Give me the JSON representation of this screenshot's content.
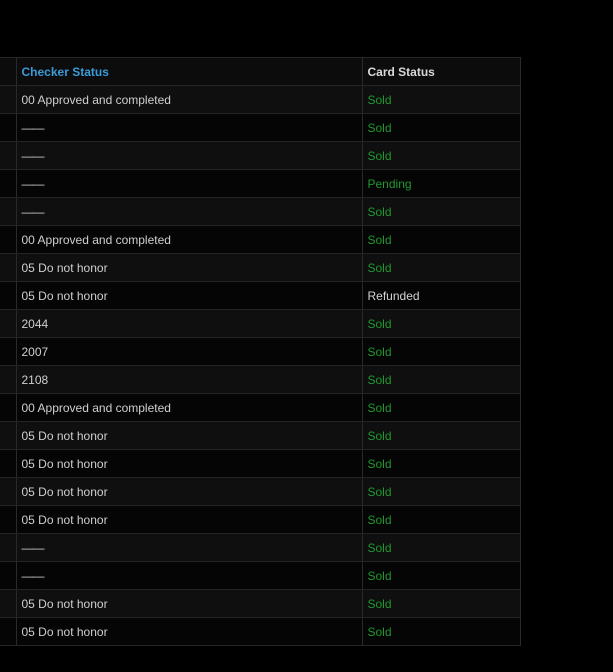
{
  "table": {
    "headers": {
      "checker_status": "Checker Status",
      "card_status": "Card Status"
    },
    "rows": [
      {
        "checker": "00 Approved and completed",
        "card": "Sold"
      },
      {
        "checker": "——",
        "card": "Sold"
      },
      {
        "checker": "——",
        "card": "Sold"
      },
      {
        "checker": "——",
        "card": "Pending"
      },
      {
        "checker": "——",
        "card": "Sold"
      },
      {
        "checker": "00 Approved and completed",
        "card": "Sold"
      },
      {
        "checker": "05 Do not honor",
        "card": "Sold"
      },
      {
        "checker": "05 Do not honor",
        "card": "Refunded"
      },
      {
        "checker": "2044",
        "card": "Sold"
      },
      {
        "checker": "2007",
        "card": "Sold"
      },
      {
        "checker": "2108",
        "card": "Sold"
      },
      {
        "checker": "00 Approved and completed",
        "card": "Sold"
      },
      {
        "checker": "05 Do not honor",
        "card": "Sold"
      },
      {
        "checker": "05 Do not honor",
        "card": "Sold"
      },
      {
        "checker": "05 Do not honor",
        "card": "Sold"
      },
      {
        "checker": "05 Do not honor",
        "card": "Sold"
      },
      {
        "checker": "——",
        "card": "Sold"
      },
      {
        "checker": "——",
        "card": "Sold"
      },
      {
        "checker": "05 Do not honor",
        "card": "Sold"
      },
      {
        "checker": "05 Do not honor",
        "card": "Sold"
      }
    ]
  },
  "colors": {
    "page_background": "#000000",
    "checker_header": "#3a9bd9",
    "card_header": "#d9d9d9",
    "checker_text": "#cfcfcf",
    "status_sold": "#1f9a2e",
    "status_pending": "#1f9a2e",
    "status_refunded": "#d4d4d4",
    "grid_line": "#2a2a2a"
  }
}
